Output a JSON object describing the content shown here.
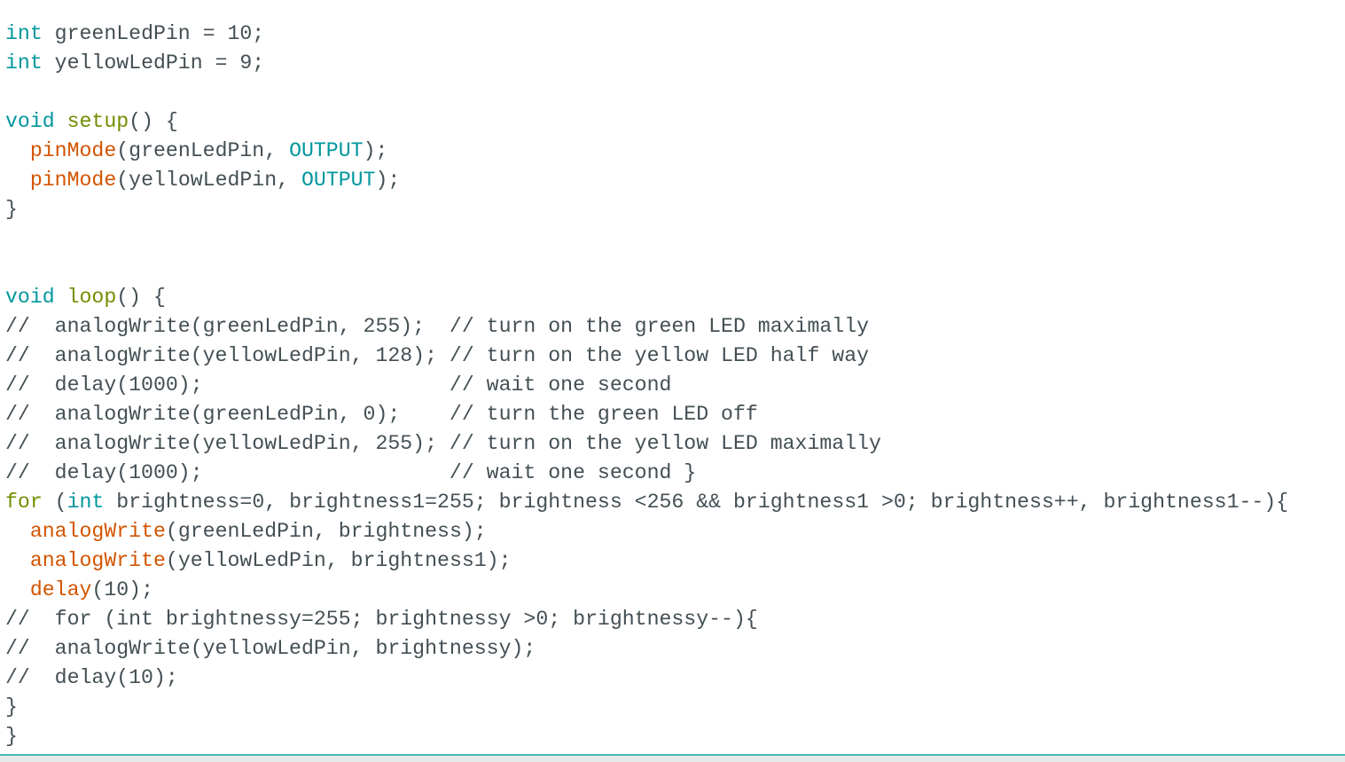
{
  "editor": {
    "lines": [
      [
        [
          "type",
          "int"
        ],
        [
          "plain",
          " greenLedPin = 10;"
        ]
      ],
      [
        [
          "type",
          "int"
        ],
        [
          "plain",
          " yellowLedPin = 9;"
        ]
      ],
      [],
      [
        [
          "type",
          "void"
        ],
        [
          "plain",
          " "
        ],
        [
          "def",
          "setup"
        ],
        [
          "plain",
          "() {"
        ]
      ],
      [
        [
          "plain",
          "  "
        ],
        [
          "func",
          "pinMode"
        ],
        [
          "plain",
          "(greenLedPin, "
        ],
        [
          "const",
          "OUTPUT"
        ],
        [
          "plain",
          ");"
        ]
      ],
      [
        [
          "plain",
          "  "
        ],
        [
          "func",
          "pinMode"
        ],
        [
          "plain",
          "(yellowLedPin, "
        ],
        [
          "const",
          "OUTPUT"
        ],
        [
          "plain",
          ");"
        ]
      ],
      [
        [
          "plain",
          "}"
        ]
      ],
      [],
      [],
      [
        [
          "type",
          "void"
        ],
        [
          "plain",
          " "
        ],
        [
          "def",
          "loop"
        ],
        [
          "plain",
          "() {"
        ]
      ],
      [
        [
          "plain",
          "//  analogWrite(greenLedPin, 255);  // turn on the green LED maximally"
        ]
      ],
      [
        [
          "plain",
          "//  analogWrite(yellowLedPin, 128); // turn on the yellow LED half way"
        ]
      ],
      [
        [
          "plain",
          "//  delay(1000);                    // wait one second"
        ]
      ],
      [
        [
          "plain",
          "//  analogWrite(greenLedPin, 0);    // turn the green LED off"
        ]
      ],
      [
        [
          "plain",
          "//  analogWrite(yellowLedPin, 255); // turn on the yellow LED maximally"
        ]
      ],
      [
        [
          "plain",
          "//  delay(1000);                    // wait one second }"
        ]
      ],
      [
        [
          "kw",
          "for"
        ],
        [
          "plain",
          " ("
        ],
        [
          "type",
          "int"
        ],
        [
          "plain",
          " brightness=0, brightness1=255; brightness <256 && brightness1 >0; brightness++, brightness1--){"
        ]
      ],
      [
        [
          "plain",
          "  "
        ],
        [
          "func",
          "analogWrite"
        ],
        [
          "plain",
          "(greenLedPin, brightness);"
        ]
      ],
      [
        [
          "plain",
          "  "
        ],
        [
          "func",
          "analogWrite"
        ],
        [
          "plain",
          "(yellowLedPin, brightness1);"
        ]
      ],
      [
        [
          "plain",
          "  "
        ],
        [
          "func",
          "delay"
        ],
        [
          "plain",
          "(10);"
        ]
      ],
      [
        [
          "plain",
          "//  for (int brightnessy=255; brightnessy >0; brightnessy--){"
        ]
      ],
      [
        [
          "plain",
          "//  analogWrite(yellowLedPin, brightnessy);"
        ]
      ],
      [
        [
          "plain",
          "//  delay(10);"
        ]
      ],
      [
        [
          "plain",
          "}"
        ]
      ],
      [
        [
          "plain",
          "}"
        ]
      ]
    ]
  },
  "colors": {
    "type": "#00979d",
    "function": "#d35400",
    "definition": "#728e00",
    "text": "#434f54",
    "accent": "#4db7bb"
  }
}
